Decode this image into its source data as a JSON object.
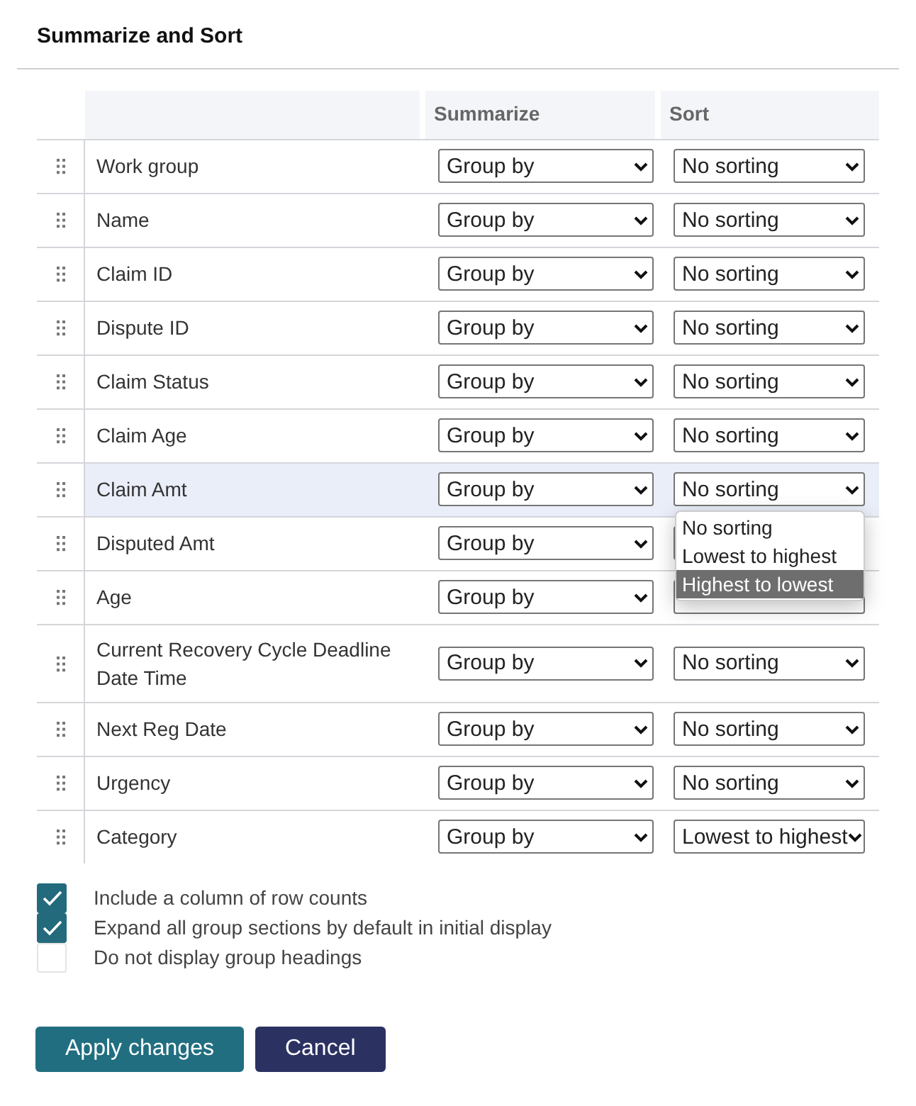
{
  "title": "Summarize and Sort",
  "columns": [
    "Summarize",
    "Sort"
  ],
  "rows": [
    {
      "name": "Work group",
      "summarize": "Group by",
      "sort": "No sorting",
      "selected": false
    },
    {
      "name": "Name",
      "summarize": "Group by",
      "sort": "No sorting",
      "selected": false
    },
    {
      "name": "Claim ID",
      "summarize": "Group by",
      "sort": "No sorting",
      "selected": false
    },
    {
      "name": "Dispute ID",
      "summarize": "Group by",
      "sort": "No sorting",
      "selected": false
    },
    {
      "name": "Claim Status",
      "summarize": "Group by",
      "sort": "No sorting",
      "selected": false
    },
    {
      "name": "Claim Age",
      "summarize": "Group by",
      "sort": "No sorting",
      "selected": false
    },
    {
      "name": "Claim Amt",
      "summarize": "Group by",
      "sort": "No sorting",
      "selected": true,
      "menu": [
        {
          "label": "No sorting",
          "selected": false
        },
        {
          "label": "Lowest to highest",
          "selected": false
        },
        {
          "label": "Highest to lowest",
          "selected": true
        }
      ]
    },
    {
      "name": "Disputed Amt",
      "summarize": "Group by",
      "selected": false
    },
    {
      "name": "Age",
      "summarize": "Group by",
      "selected": false
    },
    {
      "name": "Current Recovery Cycle Deadline Date Time",
      "summarize": "Group by",
      "sort": "No sorting",
      "selected": false
    },
    {
      "name": "Next Reg Date",
      "summarize": "Group by",
      "sort": "No sorting",
      "selected": false
    },
    {
      "name": "Urgency",
      "summarize": "Group by",
      "sort": "No sorting",
      "selected": false
    },
    {
      "name": "Category",
      "summarize": "Group by",
      "sort": "Lowest to highest",
      "selected": false
    }
  ],
  "options": [
    {
      "label": "Include a column of row counts",
      "checked": true
    },
    {
      "label": "Expand all group sections by default in initial display",
      "checked": true
    },
    {
      "label": "Do not display group headings",
      "checked": false
    }
  ],
  "buttons": [
    {
      "label": "Apply changes",
      "kind": "primary"
    },
    {
      "label": "Cancel",
      "kind": "secondary"
    }
  ]
}
